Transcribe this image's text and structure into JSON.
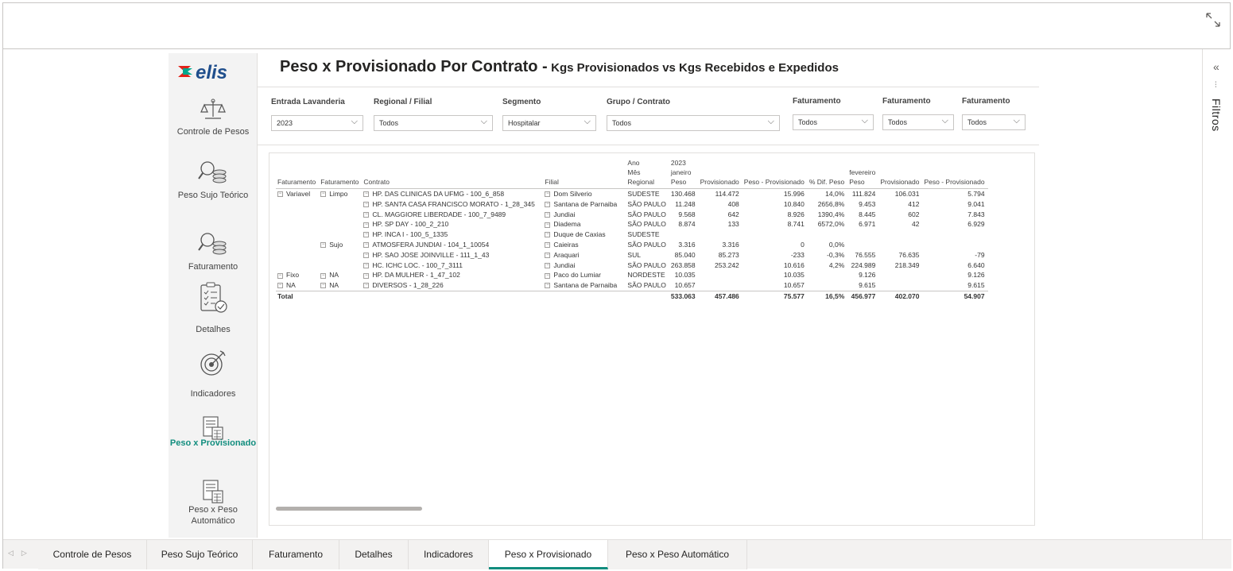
{
  "filters_pane": {
    "label": "Filtros"
  },
  "nav": {
    "logo_text": "elis",
    "items": [
      {
        "label": "Controle de Pesos"
      },
      {
        "label": "Peso Sujo Teórico"
      },
      {
        "label": "Faturamento"
      },
      {
        "label": "Detalhes"
      },
      {
        "label": "Indicadores"
      },
      {
        "label": "Peso x Provisionado"
      },
      {
        "label": "Peso x Peso Automático"
      }
    ]
  },
  "header": {
    "title": "Peso x Provisionado Por Contrato -",
    "subtitle": "Kgs Provisionados vs Kgs Recebidos e Expedidos"
  },
  "slicers": [
    {
      "label": "Entrada Lavanderia",
      "value": "2023"
    },
    {
      "label": "Regional / Filial",
      "value": "Todos"
    },
    {
      "label": "Segmento",
      "value": "Hospitalar"
    },
    {
      "label": "Grupo / Contrato",
      "value": "Todos"
    },
    {
      "label": "Faturamento",
      "value": "Todos"
    },
    {
      "label": "Faturamento",
      "value": "Todos"
    },
    {
      "label": "Faturamento",
      "value": "Todos"
    }
  ],
  "matrix": {
    "col_header_rows": {
      "ano": "Ano",
      "mes": "Mês",
      "ano_value": "2023",
      "mes_jan": "janeiro",
      "mes_fev": "fevereiro"
    },
    "columns": [
      "Faturamento",
      "Faturamento",
      "Contrato",
      "Filial",
      "Regional",
      "Peso",
      "Provisionado",
      "Peso - Provisionado",
      "% Dif. Peso",
      "Peso",
      "Provisionado",
      "Peso - Provisionado"
    ],
    "rows": [
      [
        "Variavel",
        "Limpo",
        "HP. DAS CLINICAS DA UFMG - 100_6_858",
        "Dom Silverio",
        "SUDESTE",
        "130.468",
        "114.472",
        "15.996",
        "14,0%",
        "111.824",
        "106.031",
        "5.794"
      ],
      [
        "",
        "",
        "HP. SANTA CASA FRANCISCO MORATO - 1_28_345",
        "Santana de Parnaiba",
        "SÃO PAULO",
        "11.248",
        "408",
        "10.840",
        "2656,8%",
        "9.453",
        "412",
        "9.041"
      ],
      [
        "",
        "",
        "CL. MAGGIORE LIBERDADE - 100_7_9489",
        "Jundiai",
        "SÃO PAULO",
        "9.568",
        "642",
        "8.926",
        "1390,4%",
        "8.445",
        "602",
        "7.843"
      ],
      [
        "",
        "",
        "HP. SP DAY - 100_2_210",
        "Diadema",
        "SÃO PAULO",
        "8.874",
        "133",
        "8.741",
        "6572,0%",
        "6.971",
        "42",
        "6.929"
      ],
      [
        "",
        "",
        "HP. INCA I - 100_5_1335",
        "Duque de Caxias",
        "SUDESTE",
        "",
        "",
        "",
        "",
        "",
        "",
        ""
      ],
      [
        "",
        "Sujo",
        "ATMOSFERA JUNDIAI - 104_1_10054",
        "Caieiras",
        "SÃO PAULO",
        "3.316",
        "3.316",
        "0",
        "0,0%",
        "",
        "",
        ""
      ],
      [
        "",
        "",
        "HP. SAO JOSE JOINVILLE - 111_1_43",
        "Araquari",
        "SUL",
        "85.040",
        "85.273",
        "-233",
        "-0,3%",
        "76.555",
        "76.635",
        "-79"
      ],
      [
        "",
        "",
        "HC. ICHC LOC. - 100_7_3111",
        "Jundiai",
        "SÃO PAULO",
        "263.858",
        "253.242",
        "10.616",
        "4,2%",
        "224.989",
        "218.349",
        "6.640"
      ],
      [
        "Fixo",
        "NA",
        "HP. DA MULHER - 1_47_102",
        "Paco do Lumiar",
        "NORDESTE",
        "10.035",
        "",
        "10.035",
        "",
        "9.126",
        "",
        "9.126"
      ],
      [
        "NA",
        "NA",
        "DIVERSOS - 1_28_226",
        "Santana de Parnaiba",
        "SÃO PAULO",
        "10.657",
        "",
        "10.657",
        "",
        "9.615",
        "",
        "9.615"
      ]
    ],
    "total": [
      "Total",
      "",
      "",
      "",
      "",
      "533.063",
      "457.486",
      "75.577",
      "16,5%",
      "456.977",
      "402.070",
      "54.907"
    ]
  },
  "tabs": [
    {
      "label": "Controle de Pesos"
    },
    {
      "label": "Peso Sujo Teórico"
    },
    {
      "label": "Faturamento"
    },
    {
      "label": "Detalhes"
    },
    {
      "label": "Indicadores"
    },
    {
      "label": "Peso x Provisionado",
      "active": true
    },
    {
      "label": "Peso x Peso Automático"
    }
  ],
  "colors": {
    "accent": "#118d7e",
    "logo_red": "#e2231a",
    "logo_green": "#00a88e"
  }
}
